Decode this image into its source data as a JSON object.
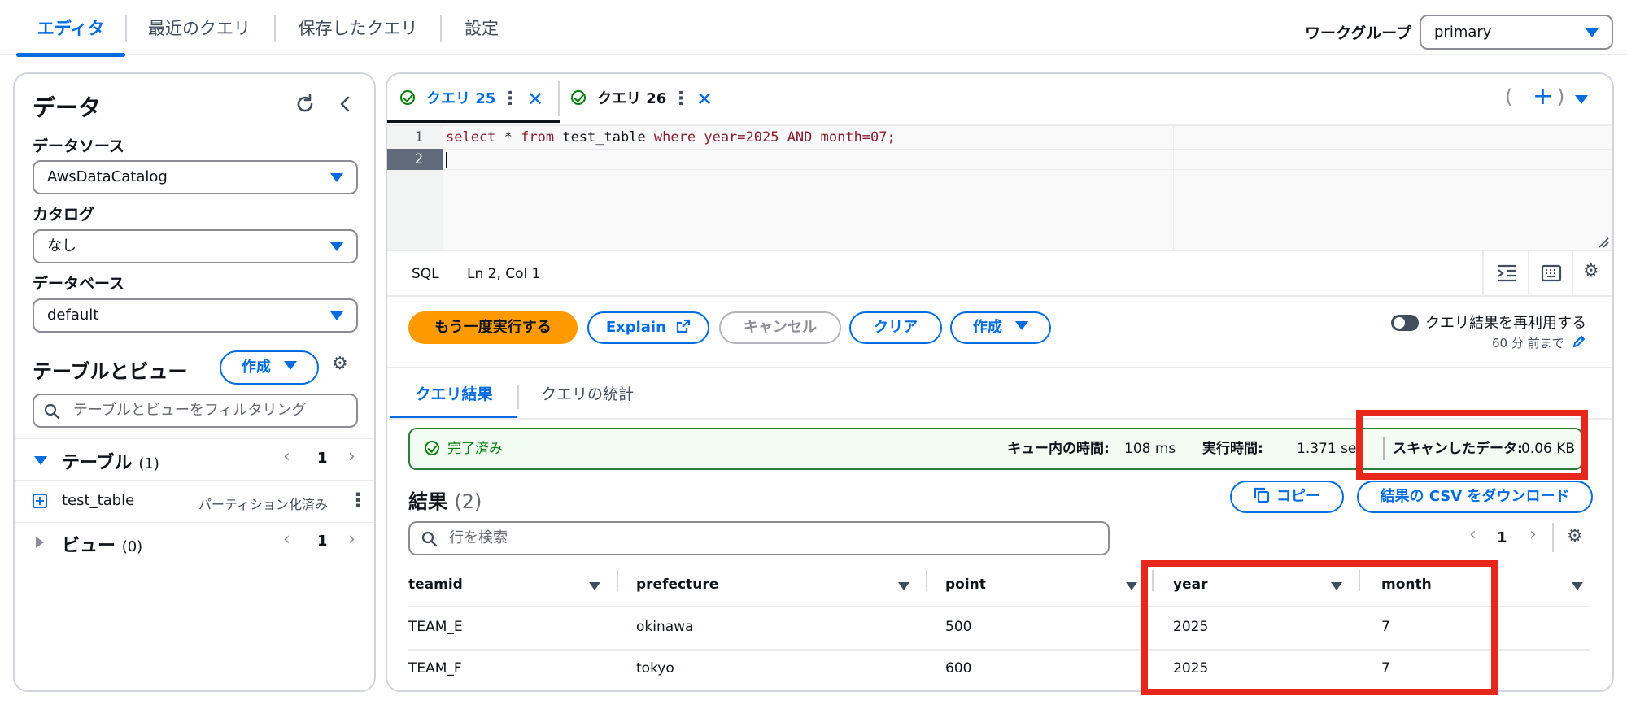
{
  "topnav": {
    "tabs": [
      {
        "label": "エディタ",
        "active": true
      },
      {
        "label": "最近のクエリ"
      },
      {
        "label": "保存したクエリ"
      },
      {
        "label": "設定"
      }
    ],
    "workgroup_label": "ワークグループ",
    "workgroup_value": "primary"
  },
  "sidebar": {
    "title": "データ",
    "datasource_label": "データソース",
    "datasource_value": "AwsDataCatalog",
    "catalog_label": "カタログ",
    "catalog_value": "なし",
    "database_label": "データベース",
    "database_value": "default",
    "tables_views_title": "テーブルとビュー",
    "create_label": "作成",
    "filter_placeholder": "テーブルとビューをフィルタリング",
    "tables_label": "テーブル",
    "tables_count": "(1)",
    "tables_page": "1",
    "table_item": {
      "name": "test_table",
      "badge": "パーティション化済み"
    },
    "views_label": "ビュー",
    "views_count": "(0)",
    "views_page": "1"
  },
  "query_tabs": [
    {
      "label": "クエリ 25",
      "active": true
    },
    {
      "label": "クエリ 26"
    }
  ],
  "editor": {
    "line1_no": "1",
    "line2_no": "2",
    "code": {
      "t1": "select",
      "t2": " * ",
      "t3": "from",
      "t4": " test_table ",
      "t5": "where",
      "t6": " year=2025 AND month=07;"
    },
    "paren_open": "(",
    "paren_close": ")",
    "plus": "+"
  },
  "statusbar": {
    "lang": "SQL",
    "cursor": "Ln 2, Col 1"
  },
  "actions": {
    "rerun": "もう一度実行する",
    "explain": "Explain",
    "cancel": "キャンセル",
    "clear": "クリア",
    "create": "作成",
    "reuse_label": "クエリ結果を再利用する",
    "reuse_age": "60 分 前まで"
  },
  "result_tabs": {
    "results": "クエリ結果",
    "stats": "クエリの統計"
  },
  "banner": {
    "status": "完了済み",
    "queue_label": "キュー内の時間:",
    "queue_value": "108 ms",
    "exec_label": "実行時間:",
    "exec_value": "1.371 sec",
    "scanned_label": "スキャンしたデータ:",
    "scanned_value": "0.06 KB"
  },
  "results": {
    "title": "結果",
    "count": "(2)",
    "copy": "コピー",
    "download": "結果の CSV をダウンロード",
    "search_placeholder": "行を検索",
    "page": "1",
    "columns": [
      "teamid",
      "prefecture",
      "point",
      "year",
      "month"
    ],
    "rows": [
      [
        "TEAM_E",
        "okinawa",
        "500",
        "2025",
        "7"
      ],
      [
        "TEAM_F",
        "tokyo",
        "600",
        "2025",
        "7"
      ]
    ]
  },
  "colors": {
    "accent": "#006ce0",
    "primary_button": "#ff9900",
    "success": "#037f0c",
    "highlight": "#e8271c"
  }
}
